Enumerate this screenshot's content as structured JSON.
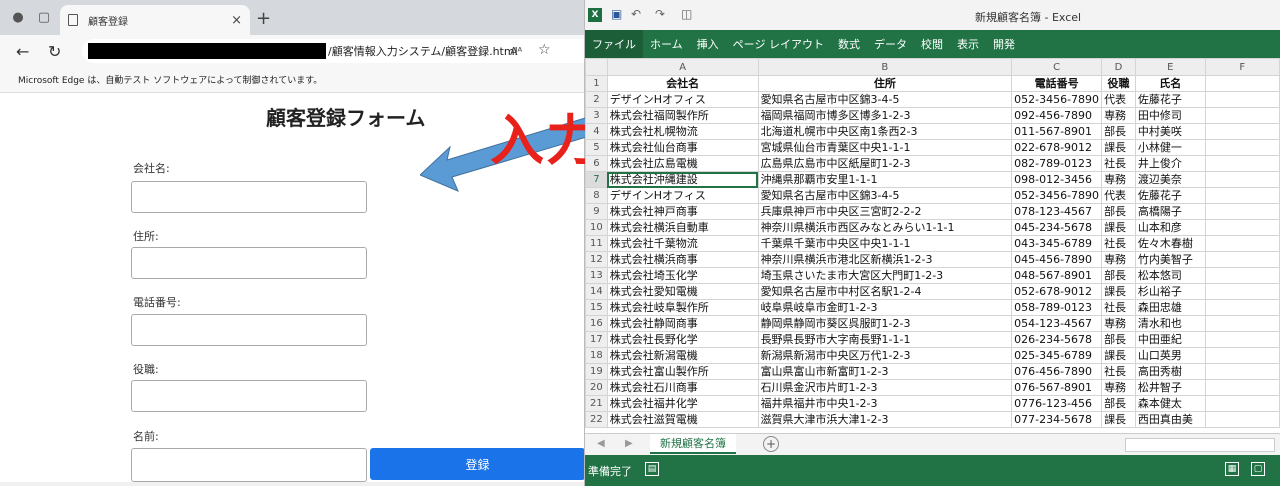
{
  "browser": {
    "tab_title": "顧客登録",
    "tab_close": "×",
    "new_tab": "+",
    "url_path": "/顧客情報入力システム/顧客登録.html",
    "read_aloud": "Aᴬ",
    "favorite": "☆",
    "info_bar": "Microsoft Edge は、自動テスト ソフトウェアによって制御されています。"
  },
  "form": {
    "title": "顧客登録フォーム",
    "fields": [
      {
        "label": "会社名:",
        "value": ""
      },
      {
        "label": "住所:",
        "value": ""
      },
      {
        "label": "電話番号:",
        "value": ""
      },
      {
        "label": "役職:",
        "value": ""
      },
      {
        "label": "名前:",
        "value": ""
      }
    ],
    "submit_label": "登録"
  },
  "annotation": {
    "text": "入力",
    "arrow_color": "#5b9bd5",
    "text_color": "#e8211b"
  },
  "excel": {
    "window_title": "新規顧客名簿 - Excel",
    "ribbon_tabs": [
      "ファイル",
      "ホーム",
      "挿入",
      "ページ レイアウト",
      "数式",
      "データ",
      "校閲",
      "表示",
      "開発"
    ],
    "columns": [
      "A",
      "B",
      "C",
      "D",
      "E",
      "F"
    ],
    "header": [
      "会社名",
      "住所",
      "電話番号",
      "役職",
      "氏名",
      ""
    ],
    "rows": [
      [
        "デザインHオフィス",
        "愛知県名古屋市中区錦3-4-5",
        "052-3456-7890",
        "代表",
        "佐藤花子"
      ],
      [
        "株式会社福岡製作所",
        "福岡県福岡市博多区博多1-2-3",
        "092-456-7890",
        "専務",
        "田中修司"
      ],
      [
        "株式会社札幌物流",
        "北海道札幌市中央区南1条西2-3",
        "011-567-8901",
        "部長",
        "中村美咲"
      ],
      [
        "株式会社仙台商事",
        "宮城県仙台市青葉区中央1-1-1",
        "022-678-9012",
        "課長",
        "小林健一"
      ],
      [
        "株式会社広島電機",
        "広島県広島市中区紙屋町1-2-3",
        "082-789-0123",
        "社長",
        "井上俊介"
      ],
      [
        "株式会社沖縄建設",
        "沖縄県那覇市安里1-1-1",
        "098-012-3456",
        "専務",
        "渡辺美奈"
      ],
      [
        "デザインHオフィス",
        "愛知県名古屋市中区錦3-4-5",
        "052-3456-7890",
        "代表",
        "佐藤花子"
      ],
      [
        "株式会社神戸商事",
        "兵庫県神戸市中央区三宮町2-2-2",
        "078-123-4567",
        "部長",
        "高橋陽子"
      ],
      [
        "株式会社横浜自動車",
        "神奈川県横浜市西区みなとみらい1-1-1",
        "045-234-5678",
        "課長",
        "山本和彦"
      ],
      [
        "株式会社千葉物流",
        "千葉県千葉市中央区中央1-1-1",
        "043-345-6789",
        "社長",
        "佐々木春樹"
      ],
      [
        "株式会社横浜商事",
        "神奈川県横浜市港北区新横浜1-2-3",
        "045-456-7890",
        "専務",
        "竹内美智子"
      ],
      [
        "株式会社埼玉化学",
        "埼玉県さいたま市大宮区大門町1-2-3",
        "048-567-8901",
        "部長",
        "松本悠司"
      ],
      [
        "株式会社愛知電機",
        "愛知県名古屋市中村区名駅1-2-4",
        "052-678-9012",
        "課長",
        "杉山裕子"
      ],
      [
        "株式会社岐阜製作所",
        "岐阜県岐阜市金町1-2-3",
        "058-789-0123",
        "社長",
        "森田忠雄"
      ],
      [
        "株式会社静岡商事",
        "静岡県静岡市葵区呉服町1-2-3",
        "054-123-4567",
        "専務",
        "清水和也"
      ],
      [
        "株式会社長野化学",
        "長野県長野市大字南長野1-1-1",
        "026-234-5678",
        "部長",
        "中田亜紀"
      ],
      [
        "株式会社新潟電機",
        "新潟県新潟市中央区万代1-2-3",
        "025-345-6789",
        "課長",
        "山口英男"
      ],
      [
        "株式会社富山製作所",
        "富山県富山市新富町1-2-3",
        "076-456-7890",
        "社長",
        "高田秀樹"
      ],
      [
        "株式会社石川商事",
        "石川県金沢市片町1-2-3",
        "076-567-8901",
        "専務",
        "松井智子"
      ],
      [
        "株式会社福井化学",
        "福井県福井市中央1-2-3",
        "0776-123-456",
        "部長",
        "森本健太"
      ],
      [
        "株式会社滋賀電機",
        "滋賀県大津市浜大津1-2-3",
        "077-234-5678",
        "課長",
        "西田真由美"
      ]
    ],
    "selected_row": 7,
    "sheet_tab": "新規顧客名簿",
    "add_sheet": "+",
    "status": "準備完了"
  }
}
